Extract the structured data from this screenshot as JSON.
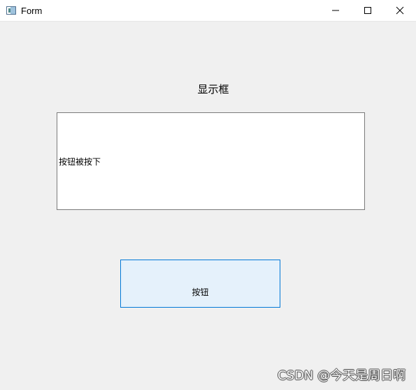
{
  "window": {
    "title": "Form",
    "icon_name": "form-window-icon",
    "controls": {
      "minimize_icon": "minimize-icon",
      "maximize_icon": "maximize-icon",
      "close_icon": "close-icon"
    }
  },
  "form": {
    "display_label": "显示框",
    "display_text": "按钮被按下",
    "button_label": "按钮"
  },
  "overlay": {
    "watermark": "CSDN @今天是周日啊"
  },
  "colors": {
    "background": "#f0f0f0",
    "titlebar": "#ffffff",
    "button_fill": "#e5f1fb",
    "button_border": "#0078d7",
    "display_border": "#7a7a7a"
  }
}
